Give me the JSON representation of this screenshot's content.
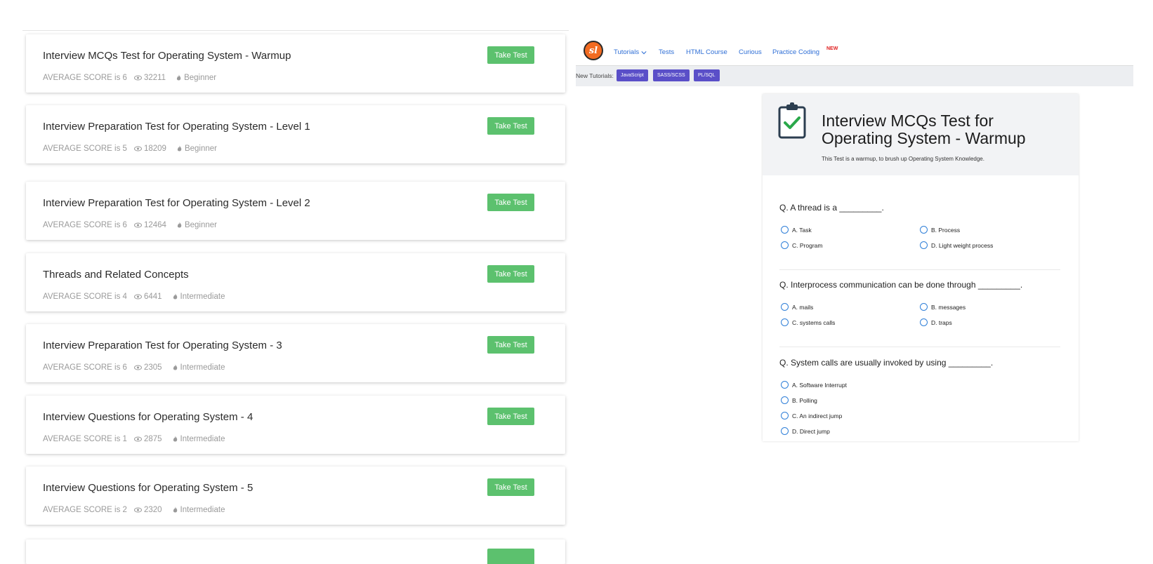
{
  "test_list": {
    "score_prefix": "AVERAGE SCORE is",
    "take_test_label": "Take Test",
    "items": [
      {
        "title": "Interview MCQs Test for Operating System - Warmup",
        "score": "6",
        "views": "32211",
        "level": "Beginner"
      },
      {
        "title": "Interview Preparation Test for Operating System - Level 1",
        "score": "5",
        "views": "18209",
        "level": "Beginner"
      },
      {
        "title": "Interview Preparation Test for Operating System - Level 2",
        "score": "6",
        "views": "12464",
        "level": "Beginner"
      },
      {
        "title": "Threads and Related Concepts",
        "score": "4",
        "views": "6441",
        "level": "Intermediate"
      },
      {
        "title": "Interview Preparation Test for Operating System - 3",
        "score": "6",
        "views": "2305",
        "level": "Intermediate"
      },
      {
        "title": "Interview Questions for Operating System - 4",
        "score": "1",
        "views": "2875",
        "level": "Intermediate"
      },
      {
        "title": "Interview Questions for Operating System - 5",
        "score": "2",
        "views": "2320",
        "level": "Intermediate"
      }
    ]
  },
  "site": {
    "logo_text": "sl",
    "nav": {
      "tutorials": "Tutorials",
      "tests": "Tests",
      "html_course": "HTML Course",
      "curious": "Curious",
      "practice_coding": "Practice Coding",
      "new_badge": "NEW"
    },
    "new_tutorials_label": "New Tutorials:",
    "tags": [
      "JavaScript",
      "SASS/SCSS",
      "PL/SQL"
    ],
    "accent_color": "#5a4fc8",
    "brand_color": "#f26b21"
  },
  "quiz": {
    "title": "Interview MCQs Test for Operating System - Warmup",
    "description": "This Test is a warmup, to brush up Operating System Knowledge.",
    "questions": [
      {
        "text": "Q. A thread is a _________.",
        "options": [
          "A. Task",
          "B. Process",
          "C. Program",
          "D. Light weight process"
        ]
      },
      {
        "text": "Q. Interprocess communication can be done through _________.",
        "options": [
          "A. mails",
          "B. messages",
          "C. systems calls",
          "D. traps"
        ]
      },
      {
        "text": "Q. System calls are usually invoked by using _________.",
        "options": [
          "A. Software Interrupt",
          "B. Polling",
          "C. An indirect jump",
          "D. Direct jump"
        ]
      }
    ]
  }
}
